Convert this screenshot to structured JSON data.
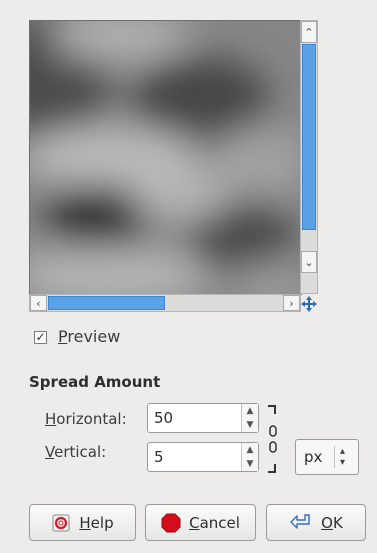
{
  "preview": {
    "checkbox_mark": "✓",
    "label_mnemonic": "P",
    "label_rest": "review",
    "checked": true
  },
  "spread": {
    "title": "Spread Amount",
    "horizontal": {
      "mnemonic": "H",
      "rest": "orizontal:",
      "value": "50"
    },
    "vertical": {
      "mnemonic": "V",
      "rest": "ertical:",
      "value": "5"
    }
  },
  "unit": {
    "value": "px"
  },
  "buttons": {
    "help": {
      "mnemonic": "H",
      "rest": "elp"
    },
    "cancel": {
      "mnemonic": "C",
      "rest": "ancel"
    },
    "ok": {
      "mnemonic": "O",
      "rest": "K"
    }
  },
  "colors": {
    "scroll_accent": "#5aa1e6",
    "window_bg": "#edeceb",
    "cancel_icon": "#d60d1a"
  },
  "icons": {
    "help": "help-icon",
    "cancel": "stop-icon",
    "ok": "ok-arrow-icon",
    "navigate": "navigate-icon",
    "chain": "chain-link-icon"
  }
}
